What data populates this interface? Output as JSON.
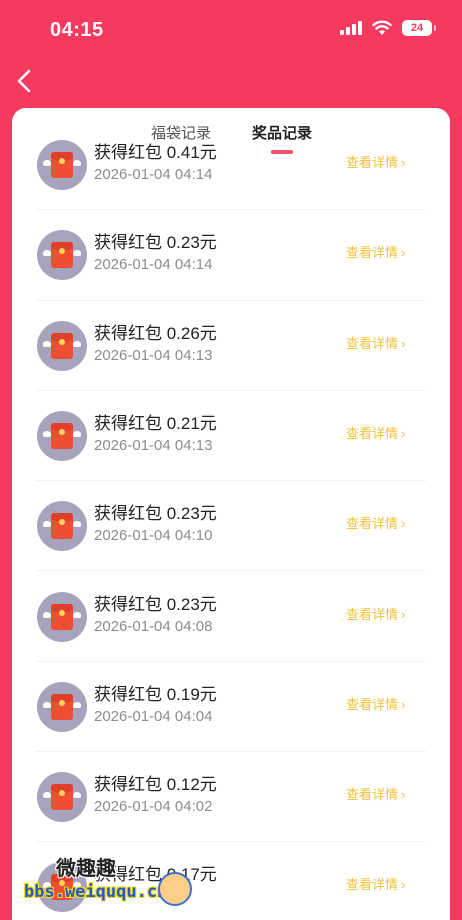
{
  "status_bar": {
    "time": "04:15",
    "battery": "24",
    "icons": [
      "signal-icon",
      "wifi-icon",
      "battery-icon"
    ]
  },
  "header": {
    "back_icon": "chevron-left-icon"
  },
  "tabs": [
    {
      "label": "福袋记录",
      "active": false
    },
    {
      "label": "奖品记录",
      "active": true
    }
  ],
  "colors": {
    "background": "#f5395f",
    "card": "#ffffff",
    "accent": "#f0506e",
    "detail_link": "#f0c23c",
    "avatar": "#a7a3bd"
  },
  "records": [
    {
      "title": "获得红包 0.41元",
      "time": "2026-01-04 04:14",
      "action": "查看详情"
    },
    {
      "title": "获得红包 0.23元",
      "time": "2026-01-04 04:14",
      "action": "查看详情"
    },
    {
      "title": "获得红包 0.26元",
      "time": "2026-01-04 04:13",
      "action": "查看详情"
    },
    {
      "title": "获得红包 0.21元",
      "time": "2026-01-04 04:13",
      "action": "查看详情"
    },
    {
      "title": "获得红包 0.23元",
      "time": "2026-01-04 04:10",
      "action": "查看详情"
    },
    {
      "title": "获得红包 0.23元",
      "time": "2026-01-04 04:08",
      "action": "查看详情"
    },
    {
      "title": "获得红包 0.19元",
      "time": "2026-01-04 04:04",
      "action": "查看详情"
    },
    {
      "title": "获得红包 0.12元",
      "time": "2026-01-04 04:02",
      "action": "查看详情"
    },
    {
      "title": "获得红包 0.17元",
      "time": "",
      "action": "查看详情"
    }
  ],
  "watermark": {
    "text": "微趣趣",
    "url": "bbs.weiququ.cn"
  }
}
